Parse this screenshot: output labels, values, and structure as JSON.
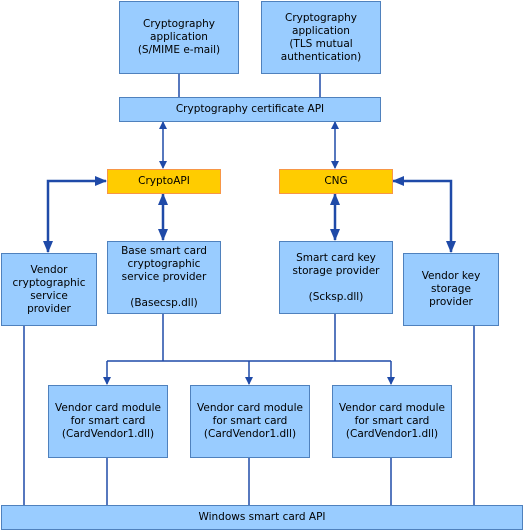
{
  "colors": {
    "box_fill": "#99ccff",
    "box_border": "#4f81bd",
    "api_fill": "#ffcc00",
    "api_border": "#f79646",
    "connector": "#1f4aa8"
  },
  "nodes": {
    "app_smime": "Cryptography\napplication\n(S/MIME e-mail)",
    "app_tls": "Cryptography\napplication\n(TLS mutual\nauthentication)",
    "cert_api": "Cryptography certificate API",
    "cryptoapi": "CryptoAPI",
    "cng": "CNG",
    "vendor_csp": "Vendor\ncryptographic\nservice\nprovider",
    "base_csp": "Base smart card\ncryptographic\nservice provider\n\n(Basecsp.dll)",
    "sc_ksp": "Smart card key\nstorage provider\n\n(Scksp.dll)",
    "vendor_ksp": "Vendor key\nstorage\nprovider",
    "card_module_1": "Vendor card module\nfor smart card\n(CardVendor1.dll)",
    "card_module_2": "Vendor card module\nfor smart card\n(CardVendor1.dll)",
    "card_module_3": "Vendor card module\nfor smart card\n(CardVendor1.dll)",
    "win_sc_api": "Windows smart card API"
  }
}
